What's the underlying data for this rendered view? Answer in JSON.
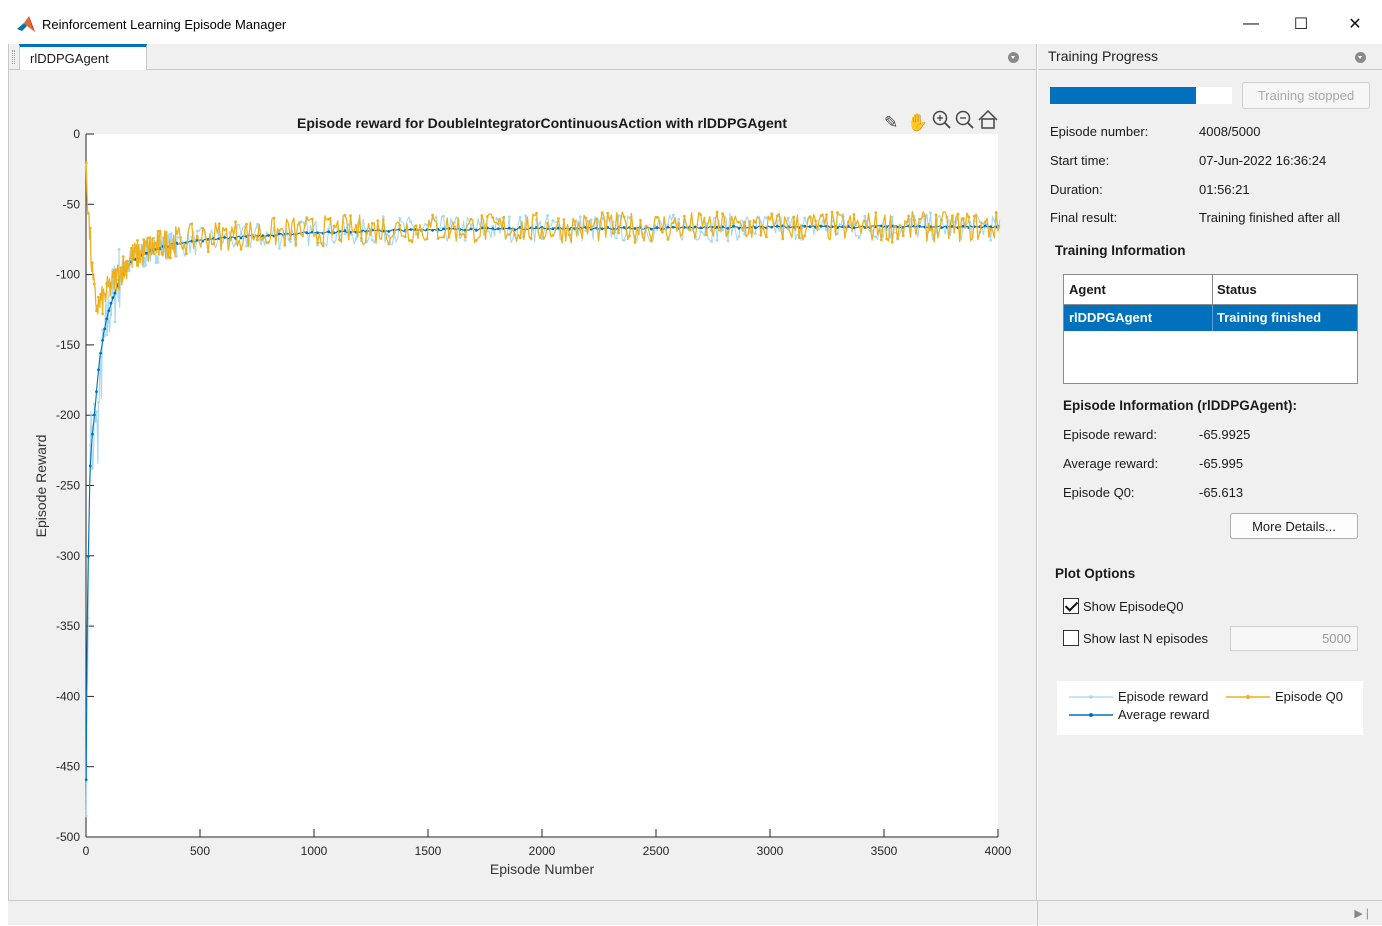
{
  "window": {
    "title": "Reinforcement Learning Episode Manager",
    "minimize_glyph": "—",
    "maximize_glyph": "☐",
    "close_glyph": "✕"
  },
  "document_tab": {
    "label": "rlDDPGAgent"
  },
  "plot_toolbar": {
    "icons": [
      "brush-icon",
      "pan-hand-icon",
      "zoom-in-icon",
      "zoom-out-icon",
      "home-icon"
    ]
  },
  "chart_data": {
    "type": "line",
    "title": "Episode reward for DoubleIntegratorContinuousAction with rlDDPGAgent",
    "xlabel": "Episode Number",
    "ylabel": "Episode Reward",
    "xlim": [
      0,
      4000
    ],
    "ylim": [
      -500,
      0
    ],
    "xticks": [
      0,
      500,
      1000,
      1500,
      2000,
      2500,
      3000,
      3500,
      4000
    ],
    "yticks": [
      0,
      -50,
      -100,
      -150,
      -200,
      -250,
      -300,
      -350,
      -400,
      -450,
      -500
    ],
    "grid": false,
    "series": [
      {
        "name": "Episode reward",
        "color": "#a7d8f0",
        "x": [
          1,
          10,
          20,
          30,
          40,
          50,
          60,
          80,
          100,
          150,
          200,
          300,
          400,
          600,
          1000,
          1500,
          2000,
          2500,
          3000,
          3500,
          4008
        ],
        "values": [
          -460,
          -330,
          -200,
          -250,
          -190,
          -220,
          -180,
          -150,
          -125,
          -100,
          -90,
          -82,
          -78,
          -75,
          -70,
          -68,
          -67,
          -67,
          -66,
          -66,
          -66
        ]
      },
      {
        "name": "Average reward",
        "color": "#0072bd",
        "x": [
          1,
          5,
          10,
          15,
          20,
          30,
          40,
          50,
          60,
          80,
          100,
          150,
          200,
          300,
          400,
          600,
          1000,
          1500,
          2000,
          2500,
          3000,
          3500,
          4008
        ],
        "values": [
          -460,
          -350,
          -300,
          -260,
          -230,
          -210,
          -195,
          -175,
          -160,
          -140,
          -125,
          -102,
          -90,
          -82,
          -78,
          -74,
          -70,
          -68,
          -67,
          -67,
          -66,
          -66,
          -66
        ]
      },
      {
        "name": "Episode Q0",
        "color": "#edb120",
        "x": [
          1,
          5,
          10,
          20,
          30,
          40,
          50,
          60,
          80,
          100,
          150,
          200,
          300,
          400,
          600,
          1000,
          1500,
          2000,
          2500,
          3000,
          3500,
          4008
        ],
        "values": [
          -18,
          -40,
          -55,
          -80,
          -105,
          -118,
          -122,
          -121,
          -117,
          -110,
          -98,
          -88,
          -80,
          -76,
          -72,
          -69,
          -67,
          -67,
          -66,
          -66,
          -66,
          -66
        ]
      }
    ]
  },
  "progress_panel": {
    "title": "Training Progress",
    "progress_fraction": 0.8016,
    "stop_button": "Training stopped",
    "rows": [
      {
        "label": "Episode number:",
        "value": "4008/5000"
      },
      {
        "label": "Start time:",
        "value": "07-Jun-2022 16:36:24"
      },
      {
        "label": "Duration:",
        "value": "01:56:21"
      },
      {
        "label": "Final result:",
        "value": "Training finished after all"
      }
    ],
    "training_info": {
      "title": "Training Information",
      "columns": [
        "Agent",
        "Status"
      ],
      "rows": [
        {
          "agent": "rlDDPGAgent",
          "status": "Training finished"
        }
      ]
    },
    "episode_info": {
      "title": "Episode Information (rlDDPGAgent):",
      "rows": [
        {
          "label": "Episode reward:",
          "value": "-65.9925"
        },
        {
          "label": "Average reward:",
          "value": "-65.995"
        },
        {
          "label": "Episode Q0:",
          "value": "-65.613"
        }
      ],
      "more_button": "More Details..."
    },
    "plot_options": {
      "title": "Plot Options",
      "show_q0_label": "Show EpisodeQ0",
      "show_q0_checked": true,
      "show_last_n_label": "Show last N episodes",
      "show_last_n_checked": false,
      "last_n_value": "5000"
    },
    "legend": {
      "episode_reward": "Episode reward",
      "average_reward": "Average reward",
      "episode_q0": "Episode Q0"
    }
  }
}
